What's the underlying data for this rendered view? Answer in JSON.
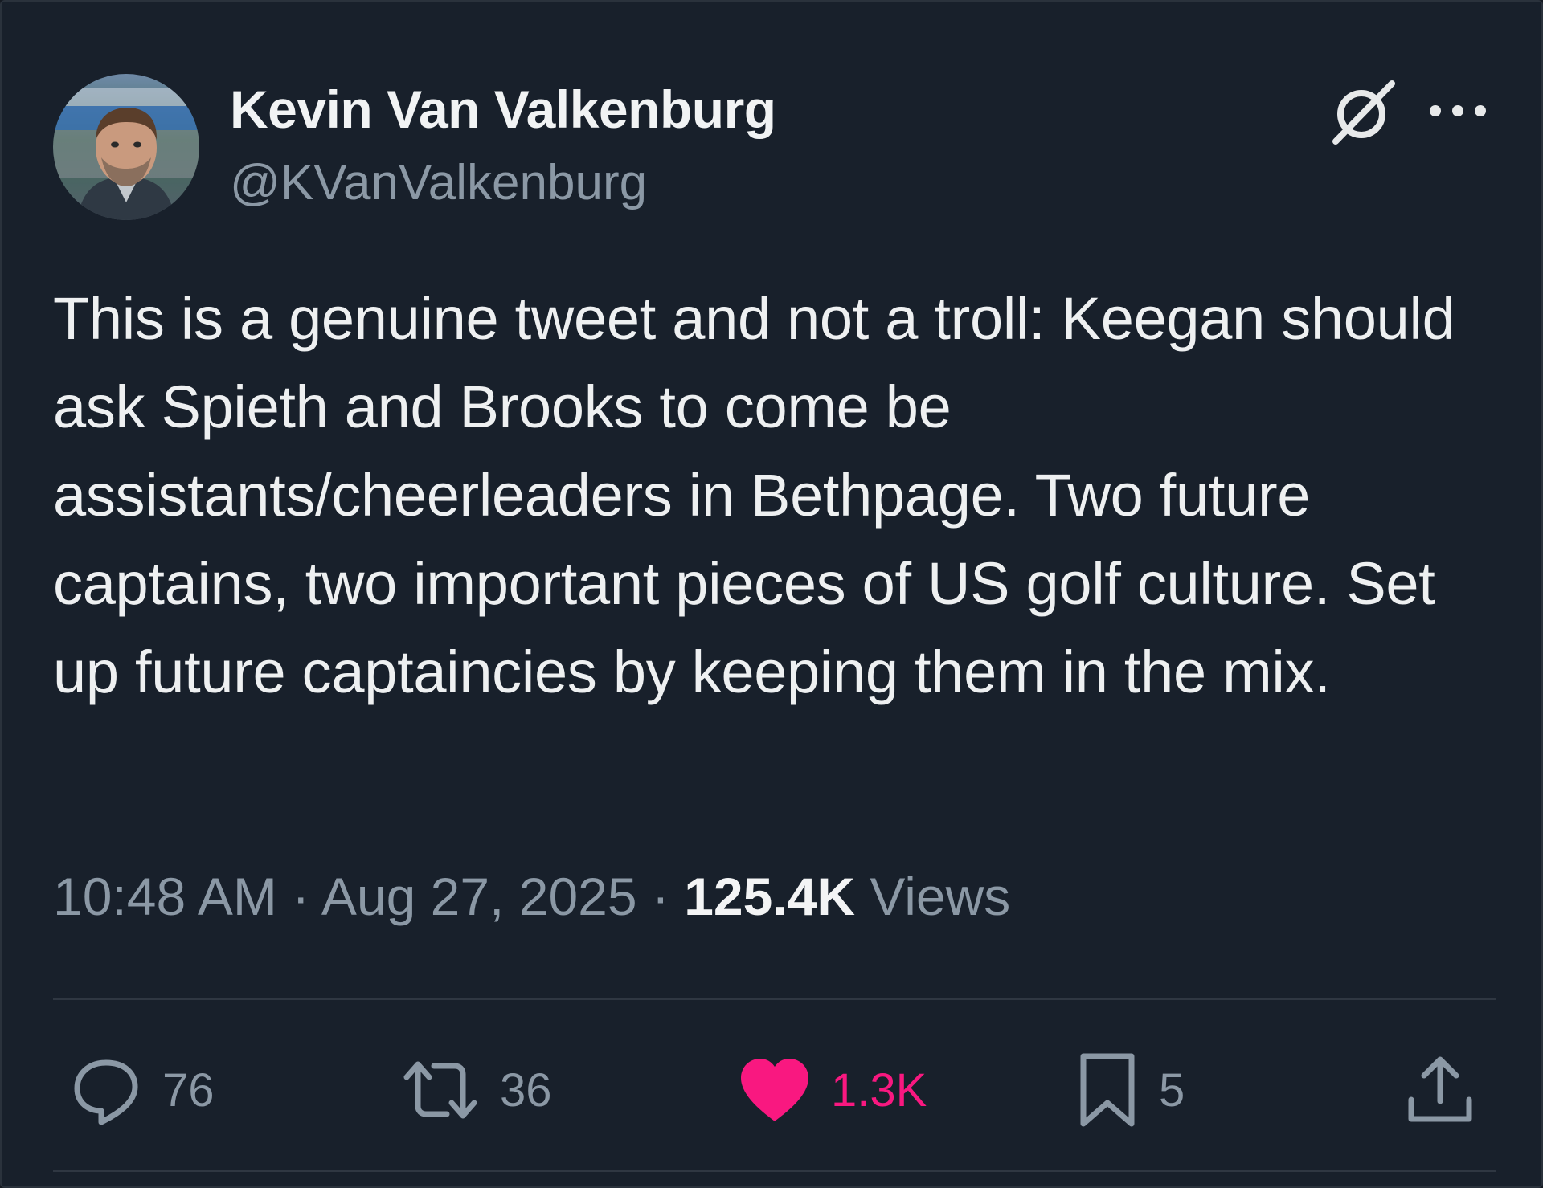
{
  "author": {
    "display_name": "Kevin Van Valkenburg",
    "handle": "@KVanValkenburg",
    "avatar_icon": "avatar-photo"
  },
  "header_actions": {
    "grok_icon": "grok-icon",
    "more_icon": "more-icon"
  },
  "tweet": {
    "text": "This is a genuine tweet and not a troll: Keegan should ask Spieth and Brooks to come be assistants/cheerleaders in Bethpage. Two future captains, two important pieces of US golf culture. Set up future captaincies by keeping them in the mix."
  },
  "meta": {
    "time": "10:48 AM",
    "sep1": " · ",
    "date": "Aug 27, 2025",
    "sep2": " · ",
    "views_count": "125.4K",
    "views_label": " Views"
  },
  "actions": {
    "replies": {
      "icon": "reply-icon",
      "count": "76"
    },
    "reposts": {
      "icon": "repost-icon",
      "count": "36"
    },
    "likes": {
      "icon": "heart-icon",
      "count": "1.3K",
      "liked": true
    },
    "bookmarks": {
      "icon": "bookmark-icon",
      "count": "5"
    },
    "share": {
      "icon": "share-icon"
    }
  },
  "colors": {
    "background": "#18202b",
    "text": "#e7e9ea",
    "secondary": "#8b98a5",
    "like": "#f91880",
    "divider": "#2f3742"
  }
}
